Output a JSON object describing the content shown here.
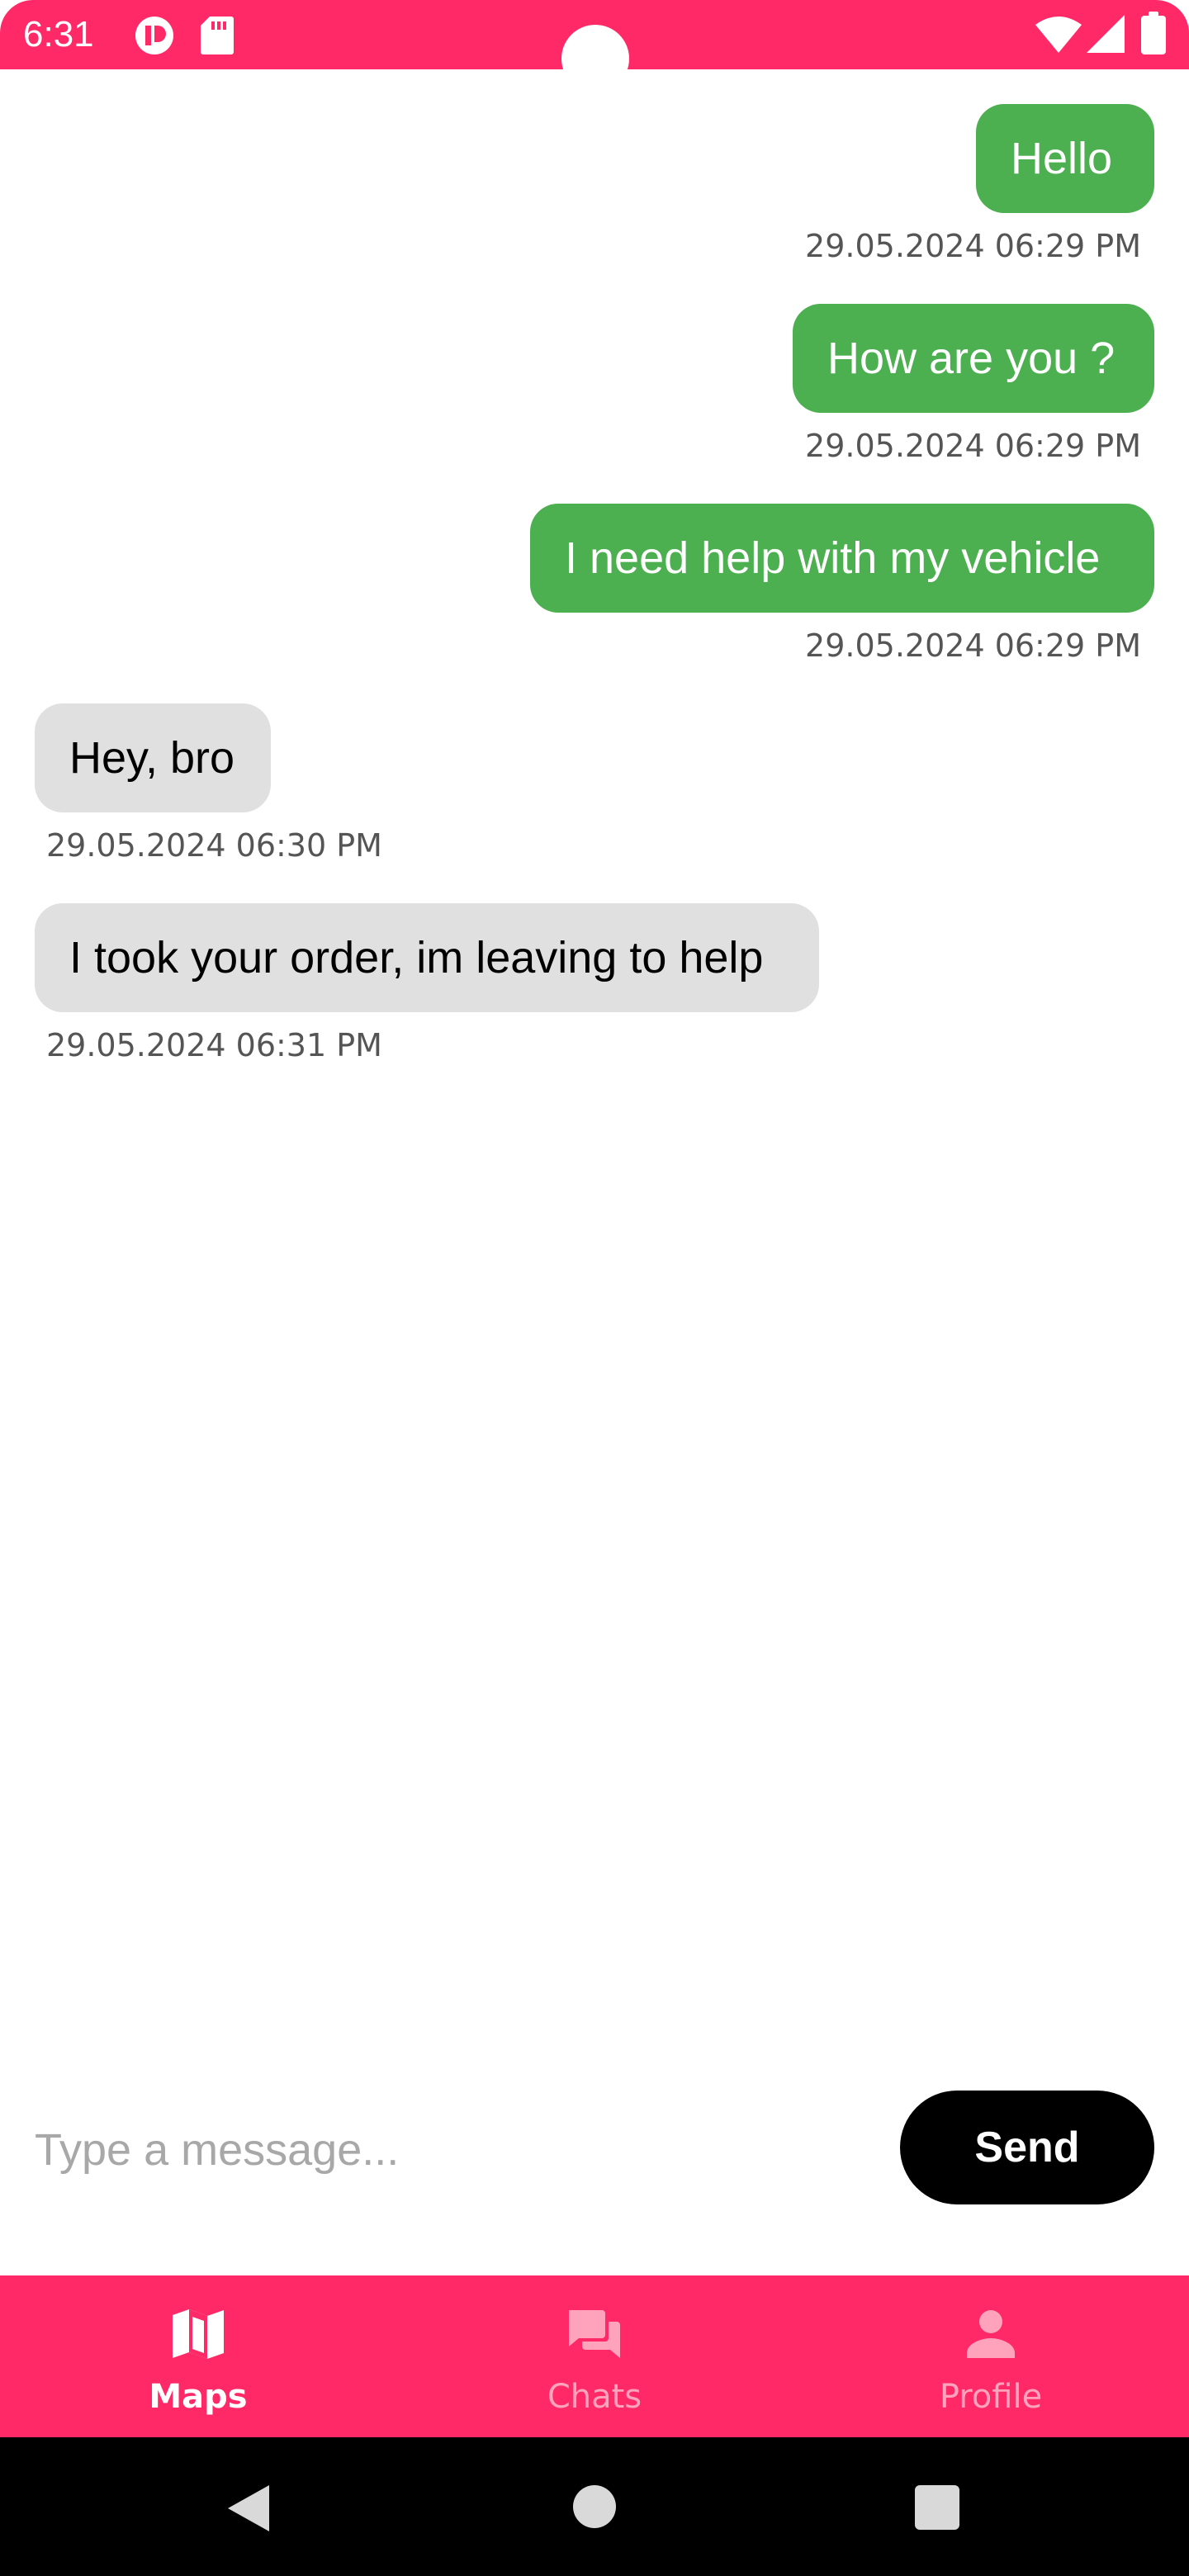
{
  "status_bar": {
    "time": "6:31",
    "icons": [
      "app-notification-icon",
      "sd-card-icon",
      "wifi-icon",
      "cellular-signal-icon",
      "battery-icon"
    ]
  },
  "messages": [
    {
      "direction": "outgoing",
      "text": "Hello",
      "timestamp": "29.05.2024 06:29 PM"
    },
    {
      "direction": "outgoing",
      "text": "How are you ?",
      "timestamp": "29.05.2024 06:29 PM"
    },
    {
      "direction": "outgoing",
      "text": "I need help with my vehicle",
      "timestamp": "29.05.2024 06:29 PM"
    },
    {
      "direction": "incoming",
      "text": "Hey, bro",
      "timestamp": "29.05.2024 06:30 PM"
    },
    {
      "direction": "incoming",
      "text": "I took your order, im leaving to help",
      "timestamp": "29.05.2024 06:31 PM"
    }
  ],
  "composer": {
    "placeholder": "Type a message...",
    "value": "",
    "send_label": "Send"
  },
  "bottom_nav": {
    "items": [
      {
        "label": "Maps",
        "icon": "map-icon",
        "active": true
      },
      {
        "label": "Chats",
        "icon": "chat-bubbles-icon",
        "active": false
      },
      {
        "label": "Profile",
        "icon": "person-icon",
        "active": false
      }
    ]
  },
  "system_nav": {
    "icons": [
      "back-icon",
      "home-icon",
      "recents-icon"
    ]
  },
  "colors": {
    "accent": "#ff2968",
    "outgoing_bubble": "#4caf50",
    "incoming_bubble": "#e0e0e0",
    "send_button": "#000000"
  }
}
